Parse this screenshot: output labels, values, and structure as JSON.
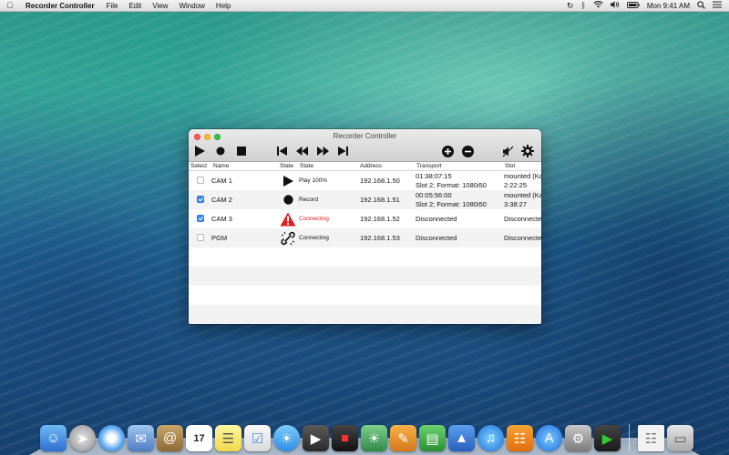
{
  "menubar": {
    "app_name": "Recorder Controller",
    "menus": [
      "File",
      "Edit",
      "View",
      "Window",
      "Help"
    ],
    "clock": "Mon 9:41 AM"
  },
  "window": {
    "title": "Recorder Controller"
  },
  "table": {
    "headers": {
      "select": "Select",
      "name": "Name",
      "state_icon": "State",
      "state": "State",
      "address": "Address",
      "transport": "Transport",
      "slot": "Slot"
    },
    "rows": [
      {
        "selected": false,
        "name": "CAM 1",
        "state_icon": "play-icon",
        "state": "Play 100%",
        "address": "192.168.1.50",
        "transport_line1": "01:38:07:15",
        "transport_line2": "Slot 2; Format: 1080i50",
        "slot_line1": "mounted (Ka",
        "slot_line2": "2:22:25"
      },
      {
        "selected": true,
        "name": "CAM 2",
        "state_icon": "record-icon",
        "state": "Record",
        "address": "192.168.1.51",
        "transport_line1": "00:05:56:00",
        "transport_line2": "Slot 2; Format: 1080i50",
        "slot_line1": "mounted (Ka",
        "slot_line2": "3:38:27"
      },
      {
        "selected": true,
        "name": "CAM 3",
        "state_icon": "warning-icon",
        "state": "Connecting",
        "address": "192.168.1.52",
        "transport_line1": "Disconnected",
        "transport_line2": "",
        "slot_line1": "Disconnecte",
        "slot_line2": ""
      },
      {
        "selected": false,
        "name": "PGM",
        "state_icon": "broken-link-icon",
        "state": "Connecting",
        "address": "192.168.1.53",
        "transport_line1": "Disconnected",
        "transport_line2": "",
        "slot_line1": "Disconnecte",
        "slot_line2": ""
      }
    ]
  },
  "colors": {
    "error_red": "#e02020",
    "checkbox_blue": "#3b8cf2"
  }
}
